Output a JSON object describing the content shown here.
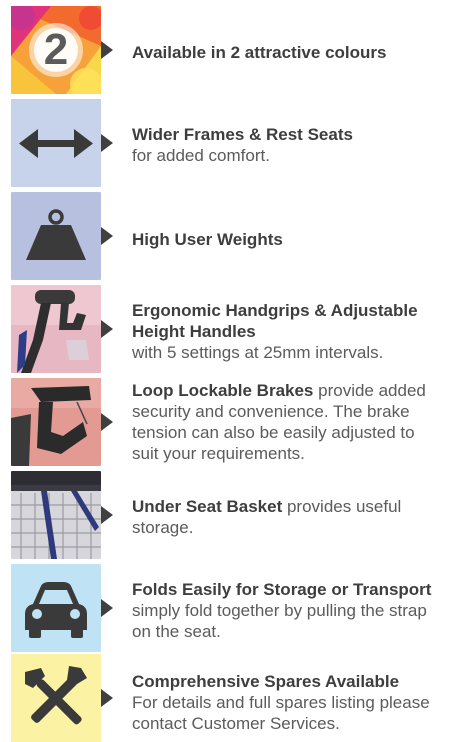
{
  "features": [
    {
      "icon": "colour-number-2-icon",
      "number": "2",
      "bold": "Available in 2 attractive colours",
      "rest": ""
    },
    {
      "icon": "double-arrow-icon",
      "bold": "Wider Frames & Rest Seats",
      "rest": "for added comfort."
    },
    {
      "icon": "weight-icon",
      "bold": "High User Weights",
      "rest": ""
    },
    {
      "icon": "handgrip-photo",
      "bold": "Ergonomic Handgrips & Adjustable Height Handles",
      "rest": "with 5 settings at 25mm intervals."
    },
    {
      "icon": "brake-photo",
      "bold": "Loop Lockable Brakes",
      "rest": "provide added security and convenience. The brake tension can also be easily adjusted to suit your requirements."
    },
    {
      "icon": "basket-photo",
      "bold": "Under Seat Basket",
      "rest": "provides useful storage."
    },
    {
      "icon": "car-icon",
      "bold": "Folds Easily for Storage or Transport",
      "rest": "simply fold together by pulling the strap on the seat."
    },
    {
      "icon": "tools-icon",
      "bold": "Comprehensive Spares Available",
      "rest": "For details and full spares listing please contact Customer Services."
    }
  ],
  "colors": {
    "pointer": "#404040",
    "icon_dark": "#3a3a3a",
    "tile_blue": "#c6d3ea",
    "tile_lilac": "#b7c0df",
    "tile_cyan": "#bfe3f4",
    "tile_yellow": "#fbf2a4"
  }
}
